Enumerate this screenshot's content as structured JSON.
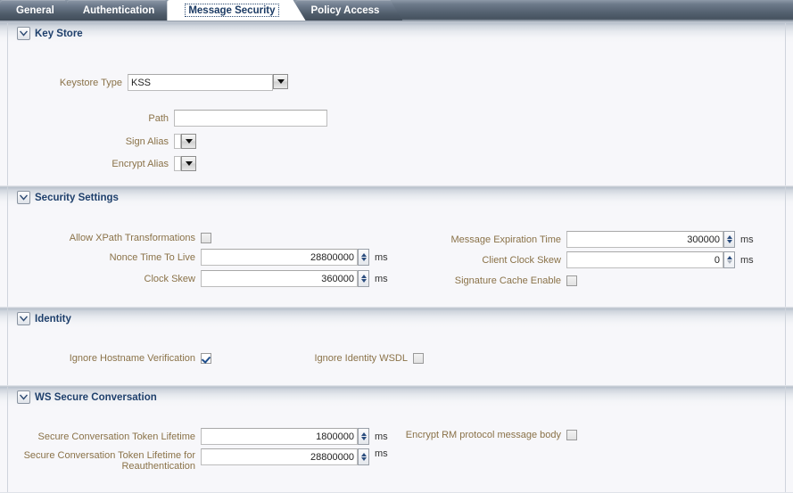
{
  "tabs": [
    {
      "label": "General",
      "active": false
    },
    {
      "label": "Authentication",
      "active": false
    },
    {
      "label": "Message Security",
      "active": true
    },
    {
      "label": "Policy Access",
      "active": false
    }
  ],
  "sections": {
    "key_store": {
      "title": "Key Store",
      "keystore_type": {
        "label": "Keystore Type",
        "value": "KSS"
      },
      "path": {
        "label": "Path",
        "value": "",
        "placeholder": ""
      },
      "sign_alias": {
        "label": "Sign Alias",
        "value": ""
      },
      "encrypt_alias": {
        "label": "Encrypt Alias",
        "value": ""
      }
    },
    "security_settings": {
      "title": "Security Settings",
      "allow_xpath": {
        "label": "Allow XPath Transformations",
        "checked": false
      },
      "nonce_ttl": {
        "label": "Nonce Time To Live",
        "value": "28800000",
        "unit": "ms"
      },
      "clock_skew": {
        "label": "Clock Skew",
        "value": "360000",
        "unit": "ms"
      },
      "message_expiration": {
        "label": "Message Expiration Time",
        "value": "300000",
        "unit": "ms"
      },
      "client_clock_skew": {
        "label": "Client Clock Skew",
        "value": "0",
        "unit": "ms"
      },
      "signature_cache": {
        "label": "Signature Cache Enable",
        "checked": false
      }
    },
    "identity": {
      "title": "Identity",
      "ignore_hostname": {
        "label": "Ignore Hostname Verification",
        "checked": true
      },
      "ignore_identity_wsdl": {
        "label": "Ignore Identity WSDL",
        "checked": false
      }
    },
    "ws_secure_conversation": {
      "title": "WS Secure Conversation",
      "token_lifetime": {
        "label": "Secure Conversation Token Lifetime",
        "value": "1800000",
        "unit": "ms"
      },
      "token_lifetime_reauth": {
        "label": "Secure Conversation Token Lifetime for Reauthentication",
        "value": "28800000",
        "unit": "ms"
      },
      "encrypt_rm": {
        "label": "Encrypt RM protocol message body",
        "checked": false
      }
    }
  },
  "icons": {
    "disclosure": "chevron-down-icon",
    "dropdown": "dropdown-arrow-icon",
    "spinner_up": "spinner-up-icon",
    "spinner_down": "spinner-down-icon"
  },
  "colors": {
    "label": "#8a7248",
    "section_title": "#1e3f6b",
    "tab_active_text": "#1b3a63",
    "tab_text": "#ffffff"
  }
}
